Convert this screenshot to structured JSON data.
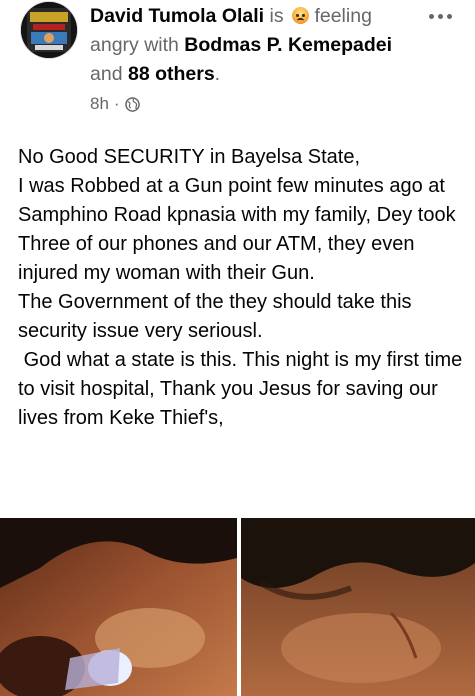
{
  "post": {
    "author": "David Tumola Olali",
    "is_word": "is",
    "feeling_text": "feeling angry with",
    "tagged_person": "Bodmas P. Kemepadei",
    "and_word": "and",
    "others": "88 others",
    "period": ".",
    "time": "8h",
    "dot_sep": "·",
    "feeling_icon": "angry-face-emoji",
    "privacy_icon": "globe-icon",
    "paragraphs": [
      "No Good SECURITY in Bayelsa State,\nI was Robbed at a Gun point few minutes ago at Samphino Road kpnasia with my family, Dey took Three of our phones and our ATM, they even injured my woman with their Gun.",
      "The Government of the they should take this security issue very seriousl.",
      " God what a state is this. This night is my first time to visit hospital, Thank you Jesus for saving our lives from Keke Thief's,"
    ]
  },
  "colors": {
    "primary_text": "#050505",
    "secondary_text": "#65676b"
  }
}
